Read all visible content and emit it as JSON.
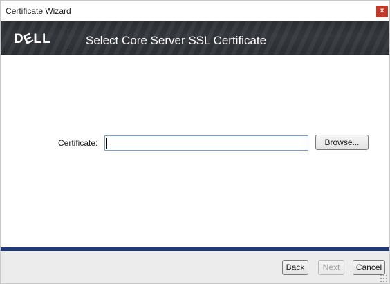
{
  "window": {
    "title": "Certificate Wizard",
    "close_label": "x"
  },
  "banner": {
    "logo": "DØLL",
    "title": "Select Core Server SSL Certificate"
  },
  "form": {
    "certificate_label": "Certificate:",
    "certificate_value": "",
    "browse_label": "Browse..."
  },
  "footer": {
    "back_label": "Back",
    "next_label": "Next",
    "next_enabled": false,
    "cancel_label": "Cancel"
  },
  "colors": {
    "banner_bg": "#2b2e33",
    "footer_line": "#1e3a78",
    "close_button": "#c0392b"
  }
}
